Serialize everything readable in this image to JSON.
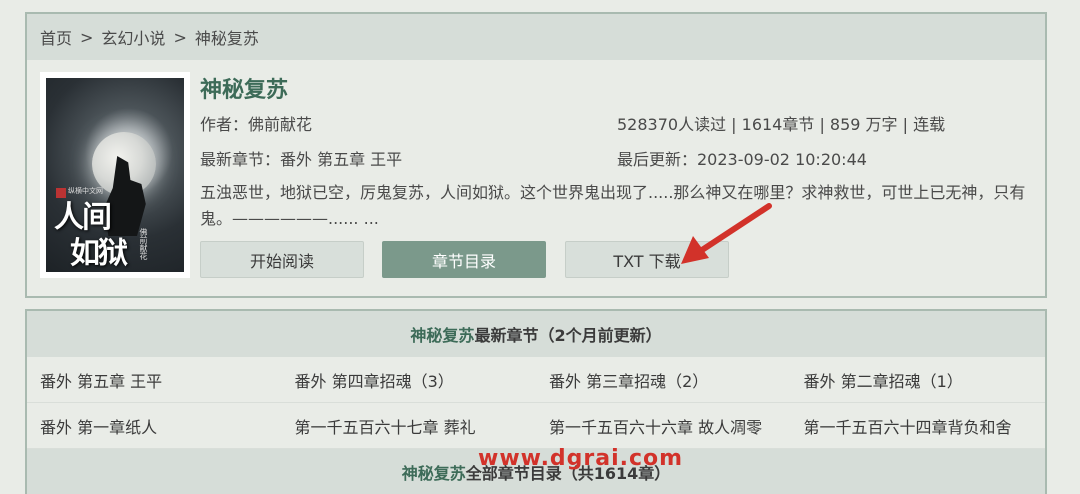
{
  "breadcrumb": {
    "home": "首页",
    "category": "玄幻小说",
    "current": "神秘复苏",
    "separator": ">"
  },
  "book": {
    "title": "神秘复苏",
    "author_line": "作者：佛前献花",
    "stats_line": "528370人读过 | 1614章节 | 859 万字 | 连载",
    "latest_line": "最新章节：番外 第五章 王平",
    "updated_line": "最后更新：2023-09-02 10:20:44",
    "description": "五浊恶世，地狱已空，厉鬼复苏，人间如狱。这个世界鬼出现了.....那么神又在哪里？求神救世，可世上已无神，只有鬼。——————...... ...",
    "cover": {
      "title_line1": "人间",
      "title_line2": "如狱",
      "publisher": "纵横中文网",
      "author": "佛前献花"
    }
  },
  "buttons": {
    "read": "开始阅读",
    "catalog": "章节目录",
    "download": "TXT 下载"
  },
  "latest_section": {
    "title_green": "神秘复苏",
    "title_rest": "最新章节（2个月前更新）"
  },
  "latest_chapters": [
    [
      "番外 第五章 王平",
      "番外 第四章招魂（3）",
      "番外 第三章招魂（2）",
      "番外 第二章招魂（1）"
    ],
    [
      "番外 第一章纸人",
      "第一千五百六十七章 葬礼",
      "第一千五百六十六章 故人凋零",
      "第一千五百六十四章背负和舍"
    ]
  ],
  "all_section": {
    "title_green": "神秘复苏",
    "title_rest": "全部章节目录（共1614章）"
  },
  "watermark": "www.dgrai.com",
  "colors": {
    "accent": "#3d6b58",
    "button_primary": "#7b998b",
    "arrow": "#d2322a"
  }
}
